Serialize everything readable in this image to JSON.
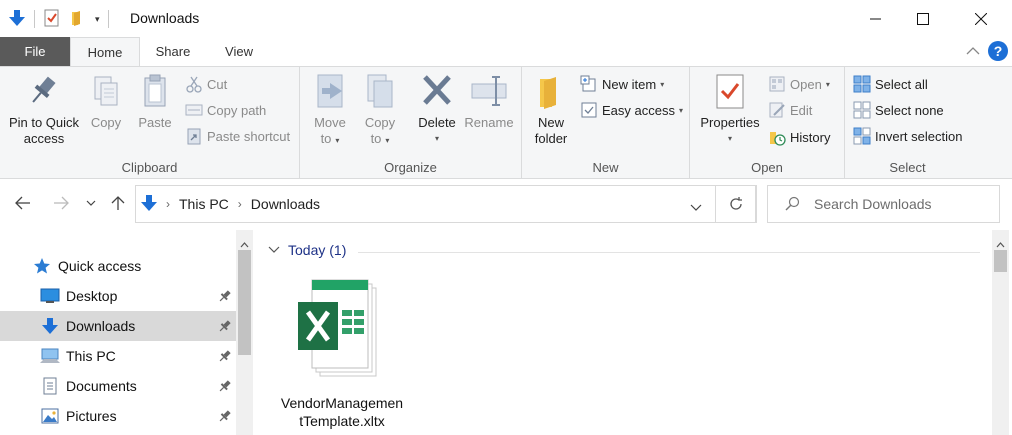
{
  "window": {
    "title": "Downloads",
    "controls": {
      "minimize": "minimize",
      "maximize": "maximize",
      "close": "close"
    }
  },
  "ribbon_tabs": {
    "file": "File",
    "home": "Home",
    "share": "Share",
    "view": "View"
  },
  "ribbon": {
    "clipboard": {
      "label": "Clipboard",
      "pin_line1": "Pin to Quick",
      "pin_line2": "access",
      "copy": "Copy",
      "paste": "Paste",
      "cut": "Cut",
      "copy_path": "Copy path",
      "paste_shortcut": "Paste shortcut"
    },
    "organize": {
      "label": "Organize",
      "move_line1": "Move",
      "move_line2": "to",
      "copy_line1": "Copy",
      "copy_line2": "to",
      "delete": "Delete",
      "rename": "Rename"
    },
    "new": {
      "label": "New",
      "folder_line1": "New",
      "folder_line2": "folder",
      "new_item": "New item",
      "easy_access": "Easy access"
    },
    "open": {
      "label": "Open",
      "properties": "Properties",
      "open": "Open",
      "edit": "Edit",
      "history": "History"
    },
    "select": {
      "label": "Select",
      "select_all": "Select all",
      "select_none": "Select none",
      "invert_selection": "Invert selection"
    }
  },
  "address_bar": {
    "crumbs": [
      "This PC",
      "Downloads"
    ],
    "search_placeholder": "Search Downloads"
  },
  "nav_pane": {
    "items": [
      {
        "label": "Quick access",
        "icon": "star-icon",
        "pinned": false
      },
      {
        "label": "Desktop",
        "icon": "desktop-icon",
        "pinned": true
      },
      {
        "label": "Downloads",
        "icon": "download-arrow-icon",
        "pinned": true,
        "selected": true
      },
      {
        "label": "This PC",
        "icon": "computer-icon",
        "pinned": true
      },
      {
        "label": "Documents",
        "icon": "documents-icon",
        "pinned": true
      },
      {
        "label": "Pictures",
        "icon": "pictures-icon",
        "pinned": true
      }
    ]
  },
  "content": {
    "group_header": "Today (1)",
    "files": [
      {
        "name": "VendorManagementTemplate.xltx",
        "icon": "excel-template-icon"
      }
    ]
  },
  "colors": {
    "accent_blue": "#1d6fd6",
    "excel_green": "#1e7145",
    "selection_gray": "#d9d9d9",
    "file_tab": "#5a5a5a"
  }
}
